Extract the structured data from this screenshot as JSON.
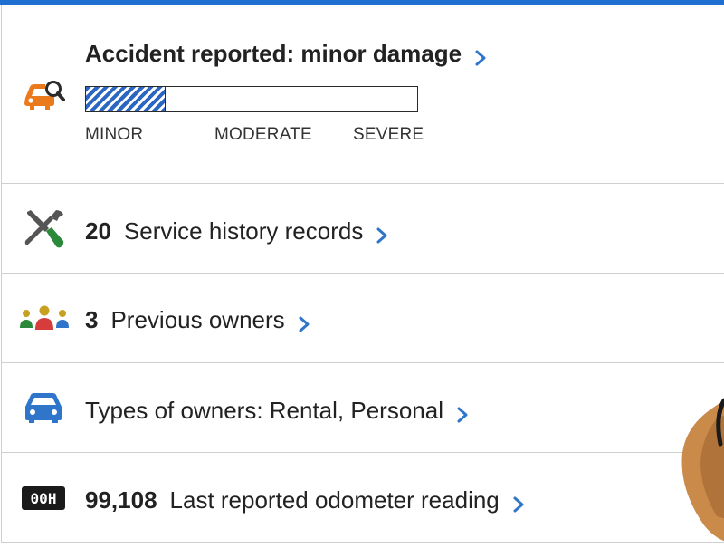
{
  "accident": {
    "title": "Accident reported: minor damage",
    "severity_level": 0.24,
    "severity_labels": [
      "MINOR",
      "MODERATE",
      "SEVERE"
    ]
  },
  "service": {
    "count": "20",
    "label": "Service history records"
  },
  "owners": {
    "count": "3",
    "label": "Previous owners"
  },
  "owner_types": {
    "label": "Types of owners: Rental, Personal"
  },
  "odometer": {
    "count": "99,108",
    "label": "Last reported odometer reading",
    "icon_text": "00H"
  },
  "colors": {
    "accent_blue": "#1f6fd1",
    "chevron_blue": "#2f75c9",
    "accident_orange": "#ea7a1c",
    "service_green": "#2a8a3a",
    "owner_red": "#d63c3c"
  },
  "icons": {
    "accident": "car-search-icon",
    "service": "wrench-screwdriver-icon",
    "owners": "people-group-icon",
    "owner_types": "car-icon",
    "odometer": "odometer-icon",
    "chevron": "chevron-right-icon"
  }
}
